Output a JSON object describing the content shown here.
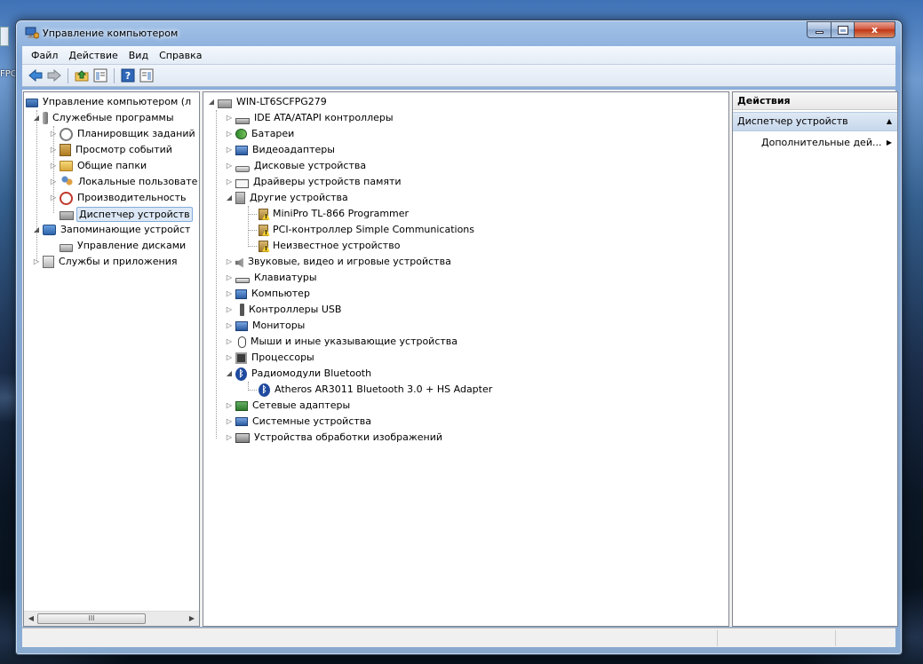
{
  "window": {
    "title": "Управление компьютером"
  },
  "desktop": {
    "icon_label": "FPC"
  },
  "menubar": {
    "items": [
      "Файл",
      "Действие",
      "Вид",
      "Справка"
    ]
  },
  "toolbar": {
    "buttons": [
      "back-icon",
      "forward-icon",
      "up-folder-icon",
      "show-hide-console-tree-icon",
      "help-icon",
      "show-hide-action-pane-icon"
    ]
  },
  "left_tree": {
    "root": "Управление компьютером (л",
    "items": [
      "Служебные программы",
      "Планировщик заданий",
      "Просмотр событий",
      "Общие папки",
      "Локальные пользовате",
      "Производительность",
      "Диспетчер устройств",
      "Запоминающие устройст",
      "Управление дисками",
      "Службы и приложения"
    ],
    "selected": "Диспетчер устройств"
  },
  "device_tree": {
    "root": "WIN-LT6SCFPG279",
    "items": [
      "IDE ATA/ATAPI контроллеры",
      "Батареи",
      "Видеоадаптеры",
      "Дисковые устройства",
      "Драйверы устройств памяти",
      "Другие устройства",
      "MiniPro TL-866 Programmer",
      "PCI-контроллер Simple Communications",
      "Неизвестное устройство",
      "Звуковые, видео и игровые устройства",
      "Клавиатуры",
      "Компьютер",
      "Контроллеры USB",
      "Мониторы",
      "Мыши и иные указывающие устройства",
      "Процессоры",
      "Радиомодули Bluetooth",
      "Atheros AR3011 Bluetooth 3.0 + HS Adapter",
      "Сетевые адаптеры",
      "Системные устройства",
      "Устройства обработки изображений"
    ]
  },
  "actions": {
    "header": "Действия",
    "section": "Диспетчер устройств",
    "item": "Дополнительные дей..."
  },
  "scrollbar": {
    "thumb_grip": "III"
  },
  "glyphs": {
    "expand": "▷",
    "collapse": "◢",
    "scroll_left": "◀",
    "scroll_right": "▶",
    "section_collapse": "▲",
    "submenu": "▶",
    "minimize": "",
    "maximize": "",
    "close": "x"
  }
}
